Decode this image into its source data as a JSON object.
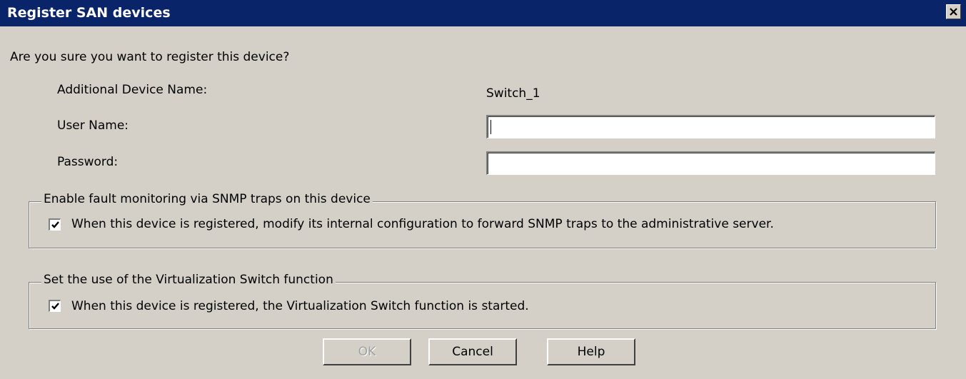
{
  "window": {
    "title": "Register SAN devices",
    "close_icon": "close-icon"
  },
  "prompt": "Are you sure you want to register this device?",
  "form": {
    "device_name_label": "Additional Device Name:",
    "device_name_value": "Switch_1",
    "user_name_label": "User Name:",
    "user_name_value": "",
    "password_label": "Password:",
    "password_value": ""
  },
  "snmp_group": {
    "legend": "Enable fault monitoring via SNMP traps on this device",
    "checkbox_label": "When this device is registered, modify its internal configuration to forward SNMP traps to the administrative server.",
    "checked": true
  },
  "virtualization_group": {
    "legend": "Set the use of the Virtualization Switch function",
    "checkbox_label": "When this device is registered, the Virtualization Switch function is started.",
    "checked": true
  },
  "buttons": {
    "ok": "OK",
    "ok_enabled": false,
    "cancel": "Cancel",
    "help": "Help"
  },
  "colors": {
    "titlebar": "#0a246a",
    "dialog_bg": "#d4d0c8"
  }
}
